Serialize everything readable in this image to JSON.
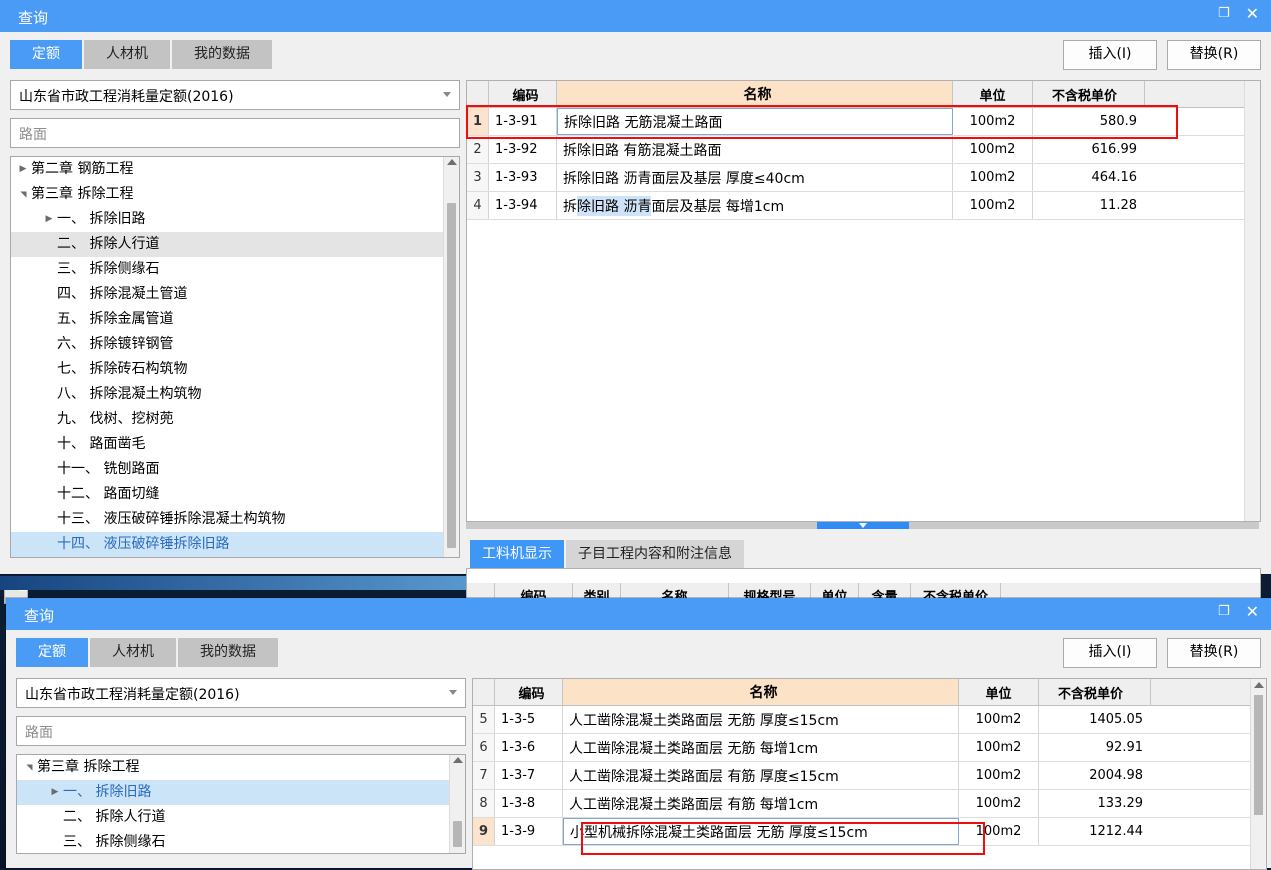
{
  "window_top": {
    "title": "查询",
    "buttons": {
      "maximize": "❐",
      "close": "✕"
    },
    "tabs": [
      {
        "label": "定额",
        "active": true
      },
      {
        "label": "人材机",
        "active": false
      },
      {
        "label": "我的数据",
        "active": false
      }
    ],
    "toolbar": {
      "insert": "插入(I)",
      "replace": "替换(R)"
    },
    "library_select": {
      "value": "山东省市政工程消耗量定额(2016)"
    },
    "search": {
      "placeholder": "路面",
      "value": ""
    },
    "tree": [
      {
        "label": "第二章 钢筋工程",
        "indent": 1,
        "expander": "collapsed",
        "state": "normal"
      },
      {
        "label": "第三章 拆除工程",
        "indent": 1,
        "expander": "expanded",
        "state": "normal"
      },
      {
        "label": "一、 拆除旧路",
        "indent": 2,
        "expander": "collapsed",
        "state": "normal"
      },
      {
        "label": "二、 拆除人行道",
        "indent": 2,
        "expander": "none",
        "state": "hover"
      },
      {
        "label": "三、 拆除侧缘石",
        "indent": 2,
        "expander": "none",
        "state": "normal"
      },
      {
        "label": "四、 拆除混凝土管道",
        "indent": 2,
        "expander": "none",
        "state": "normal"
      },
      {
        "label": "五、 拆除金属管道",
        "indent": 2,
        "expander": "none",
        "state": "normal"
      },
      {
        "label": "六、 拆除镀锌钢管",
        "indent": 2,
        "expander": "none",
        "state": "normal"
      },
      {
        "label": "七、 拆除砖石构筑物",
        "indent": 2,
        "expander": "none",
        "state": "normal"
      },
      {
        "label": "八、 拆除混凝土构筑物",
        "indent": 2,
        "expander": "none",
        "state": "normal"
      },
      {
        "label": "九、 伐树、挖树蔸",
        "indent": 2,
        "expander": "none",
        "state": "normal"
      },
      {
        "label": "十、 路面凿毛",
        "indent": 2,
        "expander": "none",
        "state": "normal"
      },
      {
        "label": "十一、 铣刨路面",
        "indent": 2,
        "expander": "none",
        "state": "normal"
      },
      {
        "label": "十二、 路面切缝",
        "indent": 2,
        "expander": "none",
        "state": "normal"
      },
      {
        "label": "十三、 液压破碎锤拆除混凝土构筑物",
        "indent": 2,
        "expander": "none",
        "state": "normal"
      },
      {
        "label": "十四、 液压破碎锤拆除旧路",
        "indent": 2,
        "expander": "none",
        "state": "selected"
      }
    ],
    "grid": {
      "columns": [
        "",
        "编码",
        "名称",
        "单位",
        "不含税单价"
      ],
      "rows": [
        {
          "idx": "1",
          "code": "1-3-91",
          "name": "拆除旧路 无筋混凝土路面",
          "unit": "100m2",
          "price": "580.9",
          "current": true
        },
        {
          "idx": "2",
          "code": "1-3-92",
          "name": "拆除旧路 有筋混凝土路面",
          "unit": "100m2",
          "price": "616.99",
          "current": false
        },
        {
          "idx": "3",
          "code": "1-3-93",
          "name": "拆除旧路 沥青面层及基层 厚度≤40cm",
          "unit": "100m2",
          "price": "464.16",
          "current": false
        },
        {
          "idx": "4",
          "code": "1-3-94",
          "name_parts": [
            {
              "t": "拆",
              "hl": false
            },
            {
              "t": "除旧路 沥青",
              "hl": true
            },
            {
              "t": "面层及基层 每增1cm",
              "hl": false
            }
          ],
          "name": "拆除旧路 沥青面层及基层 每增1cm",
          "unit": "100m2",
          "price": "11.28",
          "current": false
        }
      ]
    },
    "sub_tabs": [
      {
        "label": "工料机显示",
        "active": true
      },
      {
        "label": "子目工程内容和附注信息",
        "active": false
      }
    ],
    "sub_grid": {
      "columns": [
        "",
        "编码",
        "类别",
        "名称",
        "规格型号",
        "单位",
        "含量",
        "不含税单价"
      ]
    }
  },
  "window_bottom": {
    "title": "查询",
    "buttons": {
      "maximize": "❐",
      "close": "✕"
    },
    "tabs": [
      {
        "label": "定额",
        "active": true
      },
      {
        "label": "人材机",
        "active": false
      },
      {
        "label": "我的数据",
        "active": false
      }
    ],
    "toolbar": {
      "insert": "插入(I)",
      "replace": "替换(R)"
    },
    "library_select": {
      "value": "山东省市政工程消耗量定额(2016)"
    },
    "search": {
      "placeholder": "路面",
      "value": ""
    },
    "tree": [
      {
        "label": "第三章 拆除工程",
        "indent": 1,
        "expander": "expanded",
        "state": "normal"
      },
      {
        "label": "一、 拆除旧路",
        "indent": 2,
        "expander": "collapsed",
        "state": "selected"
      },
      {
        "label": "二、 拆除人行道",
        "indent": 2,
        "expander": "none",
        "state": "normal"
      },
      {
        "label": "三、 拆除侧缘石",
        "indent": 2,
        "expander": "none",
        "state": "normal"
      }
    ],
    "grid": {
      "columns": [
        "",
        "编码",
        "名称",
        "单位",
        "不含税单价"
      ],
      "rows": [
        {
          "idx": "5",
          "code": "1-3-5",
          "name": "人工凿除混凝土类路面层 无筋 厚度≤15cm",
          "unit": "100m2",
          "price": "1405.05",
          "current": false
        },
        {
          "idx": "6",
          "code": "1-3-6",
          "name": "人工凿除混凝土类路面层 无筋 每增1cm",
          "unit": "100m2",
          "price": "92.91",
          "current": false
        },
        {
          "idx": "7",
          "code": "1-3-7",
          "name": "人工凿除混凝土类路面层 有筋 厚度≤15cm",
          "unit": "100m2",
          "price": "2004.98",
          "current": false
        },
        {
          "idx": "8",
          "code": "1-3-8",
          "name": "人工凿除混凝土类路面层 有筋 每增1cm",
          "unit": "100m2",
          "price": "133.29",
          "current": false
        },
        {
          "idx": "9",
          "code": "1-3-9",
          "name": "小型机械拆除混凝土类路面层 无筋 厚度≤15cm",
          "unit": "100m2",
          "price": "1212.44",
          "current": true
        }
      ]
    }
  },
  "colors": {
    "title_blue": "#4a9bf5",
    "tab_active": "#4a9bf5",
    "tab_inactive": "#c3c3c3",
    "name_header": "#fce3c8",
    "selection_blue": "#cce4f7",
    "highlight_red": "#f20d0d",
    "text_selection": "#cfe2f7",
    "desktop": "#0a1930"
  }
}
